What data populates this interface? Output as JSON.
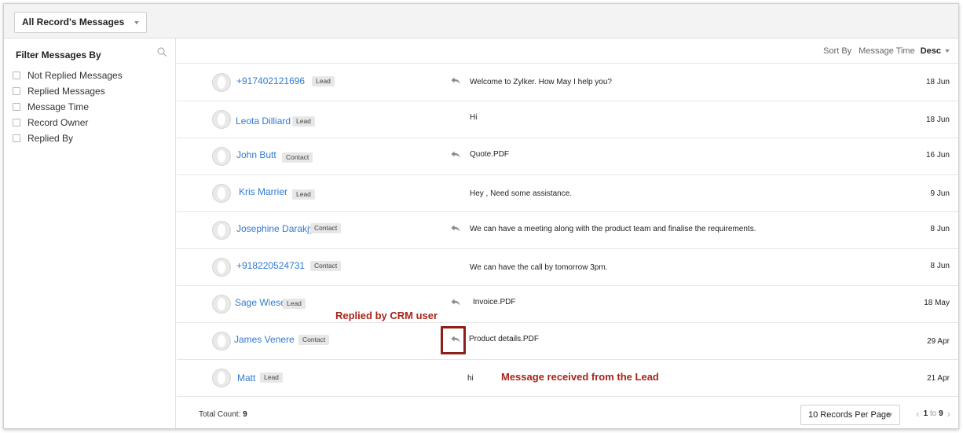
{
  "view_selector": {
    "label": "All Record's Messages"
  },
  "sidebar": {
    "title": "Filter Messages By",
    "filters": [
      {
        "label": "Not Replied Messages"
      },
      {
        "label": "Replied Messages"
      },
      {
        "label": "Message Time"
      },
      {
        "label": "Record Owner"
      },
      {
        "label": "Replied By"
      }
    ]
  },
  "sort": {
    "label": "Sort By",
    "field": "Message Time",
    "order": "Desc"
  },
  "rows": [
    {
      "name": "+917402121696",
      "type": "Lead",
      "replied": true,
      "message": "Welcome to Zylker. How May I help you?",
      "date": "18 Jun"
    },
    {
      "name": "Leota Dilliard",
      "type": "Lead",
      "replied": false,
      "message": "Hi",
      "date": "18 Jun"
    },
    {
      "name": "John Butt",
      "type": "Contact",
      "replied": true,
      "message": "Quote.PDF",
      "date": "16 Jun"
    },
    {
      "name": "Kris Marrier",
      "type": "Lead",
      "replied": false,
      "message": "Hey , Need some assistance.",
      "date": "9 Jun"
    },
    {
      "name": "Josephine Darakjy",
      "type": "Contact",
      "replied": true,
      "message": "We can have a meeting along with the product team and finalise the requirements.",
      "date": "8 Jun"
    },
    {
      "name": "+918220524731",
      "type": "Contact",
      "replied": false,
      "message": "We can have the call by tomorrow 3pm.",
      "date": "8 Jun"
    },
    {
      "name": "Sage Wiese",
      "type": "Lead",
      "replied": true,
      "message": "Invoice.PDF",
      "date": "18 May"
    },
    {
      "name": "James Venere",
      "type": "Contact",
      "replied": true,
      "message": "Product details.PDF",
      "date": "29 Apr"
    },
    {
      "name": "Matt",
      "type": "Lead",
      "replied": false,
      "message": "hi",
      "date": "21 Apr"
    }
  ],
  "footer": {
    "total_label": "Total Count:",
    "total_value": "9",
    "per_page": "10 Records Per Page",
    "range_start": "1",
    "range_sep": "to",
    "range_end": "9"
  },
  "annotations": {
    "replied_by_crm": "Replied by CRM user",
    "received_from_lead": "Message received from the Lead"
  },
  "colors": {
    "link": "#2f7bd0",
    "annotation": "#a8241a"
  }
}
